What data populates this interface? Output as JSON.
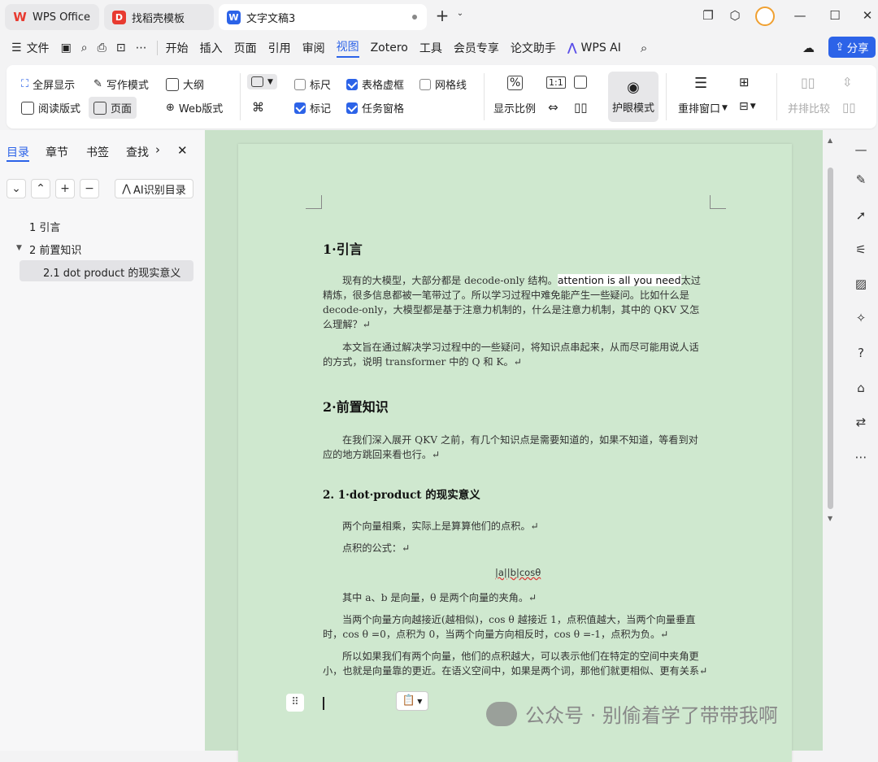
{
  "tabs": [
    {
      "label": "WPS Office"
    },
    {
      "label": "找稻壳模板"
    },
    {
      "label": "文字文稿3"
    }
  ],
  "menu": {
    "file": "文件",
    "items": [
      "开始",
      "插入",
      "页面",
      "引用",
      "审阅",
      "视图",
      "Zotero",
      "工具",
      "会员专享",
      "论文助手"
    ],
    "active": "视图",
    "wps_ai": "WPS AI",
    "share": "分享"
  },
  "ribbon": {
    "fullscreen": "全屏显示",
    "writing_mode": "写作模式",
    "outline": "大纲",
    "read_mode": "阅读版式",
    "page": "页面",
    "web": "Web版式",
    "ruler": "标尺",
    "table_gridlines": "表格虚框",
    "gridlines": "网格线",
    "marks": "标记",
    "task_pane": "任务窗格",
    "zoom": "显示比例",
    "eye_mode": "护眼模式",
    "rearrange": "重排窗口",
    "side_by_side": "并排比较",
    "checks": {
      "ruler": false,
      "table_gridlines": true,
      "gridlines": false,
      "marks": true,
      "task_pane": true
    }
  },
  "panel": {
    "tabs": [
      "目录",
      "章节",
      "书签",
      "查找"
    ],
    "active": "目录",
    "ai_button": "AI识别目录",
    "tree": [
      {
        "label": "1 引言",
        "level": 0
      },
      {
        "label": "2 前置知识",
        "level": 0,
        "expanded": true
      },
      {
        "label": "2.1 dot product 的现实意义",
        "level": 1,
        "selected": true
      }
    ]
  },
  "document": {
    "h1": "1·引言",
    "p1a": "现有的大模型，大部分都是 decode-only 结构。",
    "p1b": "attention is all you need",
    "p1c": "太过精炼，很多信息都被一笔带过了。所以学习过程中难免能产生一些疑问。比如什么是 decode-only，大模型都是基于注意力机制的，什么是注意力机制，其中的 QKV 又怎么理解？↵",
    "p2": "本文旨在通过解决学习过程中的一些疑问，将知识点串起来，从而尽可能用说人话的方式，说明 transformer 中的 Q 和 K。↵",
    "h2": "2·前置知识",
    "p3": "在我们深入展开 QKV 之前，有几个知识点是需要知道的，如果不知道，等看到对应的地方跳回来看也行。↵",
    "h3": "2. 1·dot·product 的现实意义",
    "p4": "两个向量相乘，实际上是算算他们的点积。↵",
    "p5": "点积的公式：↵",
    "formula": "|a||b|cosθ",
    "p6": "其中 a、b 是向量，θ 是两个向量的夹角。↵",
    "p7": "当两个向量方向越接近(越相似)，cos θ 越接近 1，点积值越大，当两个向量垂直时，cos θ =0，点积为 0，当两个向量方向相反时，cos θ =-1，点积为负。↵",
    "p8": "所以如果我们有两个向量，他们的点积越大，可以表示他们在特定的空间中夹角更小，也就是向量靠的更近。在语义空间中，如果是两个词，那他们就更相似、更有关系↵"
  },
  "watermark": "公众号 · 别偷着学了带带我啊",
  "colors": {
    "accent": "#2c63e8",
    "doc_bg": "#cfe8cf",
    "wps_red": "#e83a30"
  }
}
